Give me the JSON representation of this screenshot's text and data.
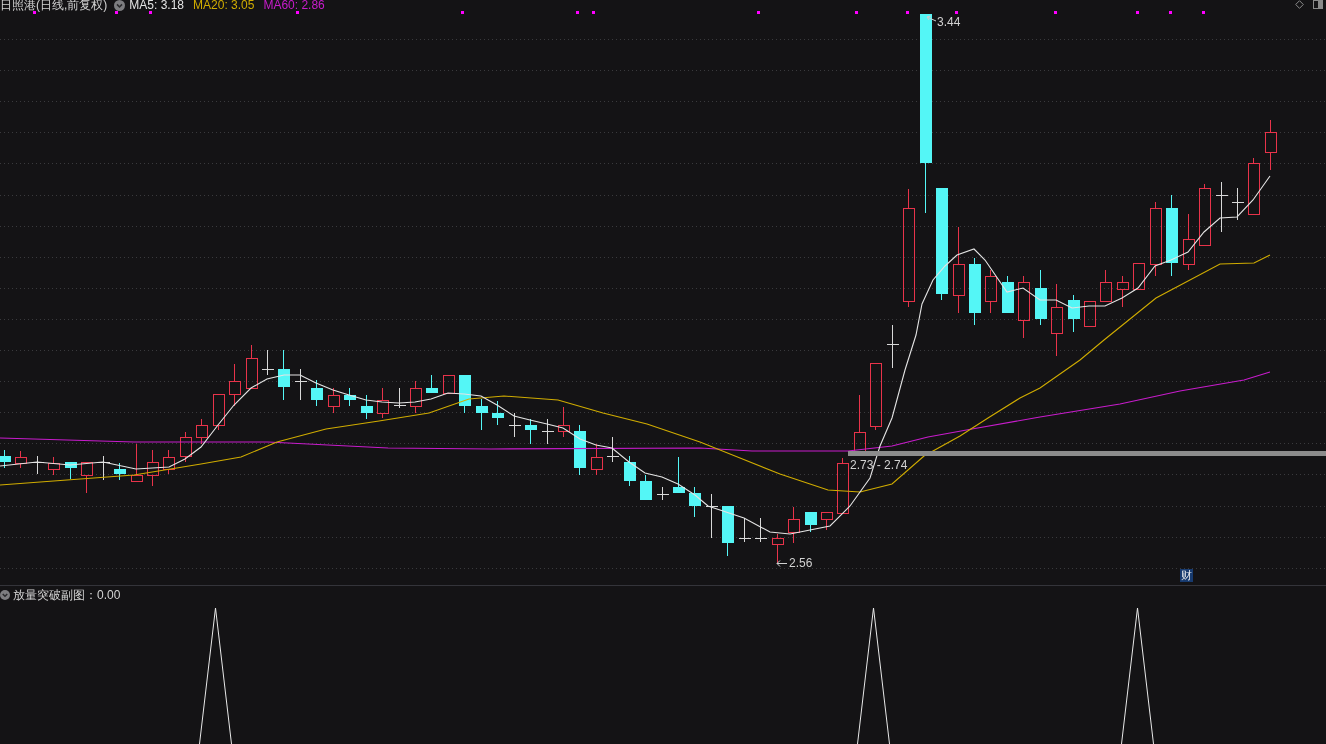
{
  "header": {
    "title": "日照港(日线,前复权)",
    "indicators": [
      {
        "label": "MA5: 3.18",
        "color": "#e4e4e4"
      },
      {
        "label": "MA20: 3.05",
        "color": "#d0ac00"
      },
      {
        "label": "MA60: 2.86",
        "color": "#c81ccc"
      }
    ]
  },
  "main_chart": {
    "high_label": "3.44",
    "low_label": "2.56",
    "range_label": "2.73 - 2.74",
    "badge": "财"
  },
  "sub_chart": {
    "title": "放量突破副图：0.00"
  }
}
